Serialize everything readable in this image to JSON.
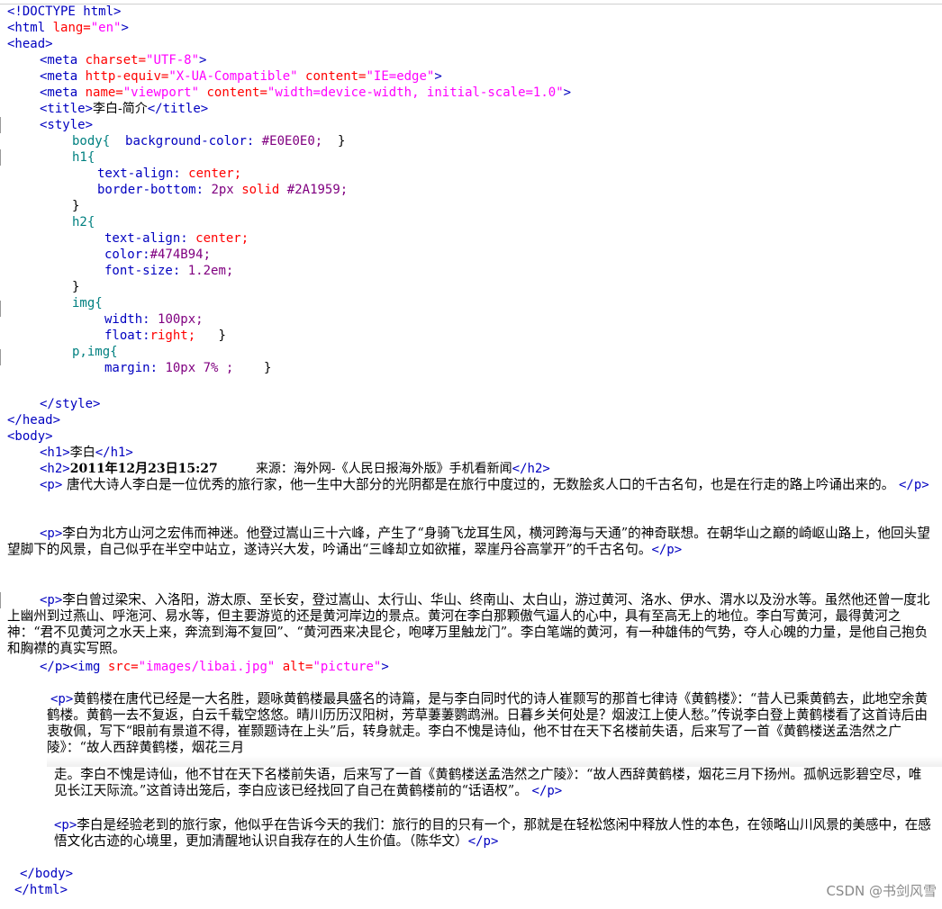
{
  "code": {
    "doctype": "<!DOCTYPE html>",
    "html_open": "<html",
    "lang_attr": "lang=",
    "lang_val": "\"en\"",
    "head_open": "<head>",
    "meta": "<meta",
    "charset_attr": "charset=",
    "charset_val": "\"UTF-8\"",
    "http_equiv_attr": "http-equiv=",
    "http_equiv_val": "\"X-UA-Compatible\"",
    "content_attr": "content=",
    "content_val_ie": "\"IE=edge\"",
    "name_attr": "name=",
    "name_val": "\"viewport\"",
    "content_val_vp": "\"width=device-width, initial-scale=1.0\"",
    "title_open": "<title>",
    "title_text": "李白-简介",
    "title_close": "</title>",
    "style_open": "<style>",
    "style_close": "</style>",
    "head_close": "</head>",
    "body_open": "<body>",
    "body_close": "</body>",
    "html_close": "</html>",
    "css": {
      "body_sel": "body{",
      "bg_prop": "background-color:",
      "bg_val": "#E0E0E0;",
      "close": "}",
      "h1_sel": "h1{",
      "text_align": "text-align:",
      "center": "center;",
      "border_bottom": "border-bottom:",
      "border_val": "2px",
      "solid": "solid",
      "border_color": "#2A1959;",
      "h2_sel": "h2{",
      "color_prop": "color:",
      "color_val": "#474B94;",
      "font_size": "font-size:",
      "font_size_val": "1.2em;",
      "img_sel": "img{",
      "width_prop": "width:",
      "width_val": "100px;",
      "float_prop": "float:",
      "float_val": "right;",
      "pimg_sel": "p,img{",
      "margin_prop": "margin:",
      "margin_val": "10px 7% ;"
    },
    "h1_open": "<h1>",
    "h1_text": "李白",
    "h1_close": "</h1>",
    "h2_open": "<h2>",
    "h2_date": "2011年12月23日15:27",
    "h2_source": "来源：海外网-《人民日报海外版》手机看新闻",
    "h2_close": "</h2>",
    "p_open": "<p>",
    "p_close": "</p>",
    "img_tag": "<img",
    "src_attr": "src=",
    "src_val": "\"images/libai.jpg\"",
    "alt_attr": "alt=",
    "alt_val": "\"picture\"",
    "gt": ">",
    "p1": "唐代大诗人李白是一位优秀的旅行家，他一生中大部分的光阴都是在旅行中度过的，无数脍炙人口的千古名句，也是在行走的路上吟诵出来的。",
    "p2": "李白为北方山河之宏伟而神迷。他登过嵩山三十六峰，产生了“身骑飞龙耳生风，横河跨海与天通”的神奇联想。在朝华山之巅的崎岖山路上，他回头望望脚下的风景，自己似乎在半空中站立，遂诗兴大发，吟诵出“三峰却立如欲摧，翠崖丹谷高掌开”的千古名句。",
    "p3": "李白曾过梁宋、入洛阳，游太原、至长安，登过嵩山、太行山、华山、终南山、太白山，游过黄河、洛水、伊水、渭水以及汾水等。虽然他还曾一度北上幽州到过燕山、呼沲河、易水等，但主要游览的还是黄河岸边的景点。黄河在李白那颗傲气逼人的心中，具有至高无上的地位。李白写黄河，最得黄河之神：“君不见黄河之水天上来，奔流到海不复回”、“黄河西来决昆仑，咆哮万里触龙门”。李白笔端的黄河，有一种雄伟的气势，夺人心魄的力量，是他自己抱负和胸襟的真实写照。",
    "p4a": "黄鹤楼在唐代已经是一大名胜，题咏黄鹤楼最具盛名的诗篇，是与李白同时代的诗人崔颢写的那首七律诗《黄鹤楼》：“昔人已乘黄鹤去，此地空余黄鹤楼。黄鹤一去不复返，白云千载空悠悠。晴川历历汉阳树，芳草萋萋鹦鹉洲。日暮乡关何处是？烟波江上使人愁。”传说李白登上黄鹤楼看了这首诗后由衷敬佩，写下“眼前有景道不得，崔颢题诗在上头”后，转身就走。李白不愧是诗仙，他不甘在天下名楼前失语，后来写了一首《黄鹤楼送孟浩然之广陵》：“故人西辞黄鹤楼，烟花三月",
    "p4b": "走。李白不愧是诗仙，他不甘在天下名楼前失语，后来写了一首《黄鹤楼送孟浩然之广陵》：“故人西辞黄鹤楼，烟花三月下扬州。孤帆远影碧空尽，唯见长江天际流。”这首诗出笼后，李白应该已经找回了自己在黄鹤楼前的“话语权”。",
    "p5": "李白是经验老到的旅行家，他似乎在告诉今天的我们：旅行的目的只有一个，那就是在轻松悠闲中释放人性的本色，在领略山川风景的美感中，在感悟文化古迹的心境里，更加清醒地认识自我存在的人生价值。（陈华文）"
  },
  "watermark": "CSDN @书剑风雪"
}
